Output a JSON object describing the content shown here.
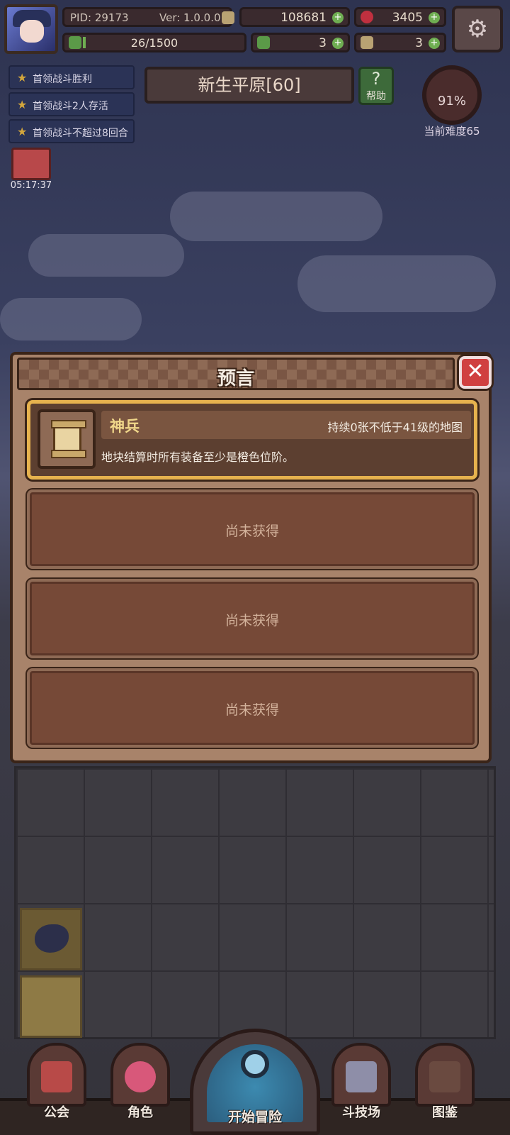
{
  "topbar": {
    "pid": "PID: 29173",
    "version": "Ver: 1.0.0.0",
    "coins": "108681",
    "gems": "3405",
    "xp": "26/1500",
    "res2": "3",
    "res3": "3",
    "xp_fraction": 0.017
  },
  "quests": [
    "首领战斗胜利",
    "首领战斗2人存活",
    "首领战斗不超过8回合"
  ],
  "chest_timer": "05:17:37",
  "map": {
    "title": "新生平原[60]",
    "help_label": "帮助",
    "difficulty_percent": "91%",
    "difficulty_label": "当前难度65"
  },
  "modal": {
    "title": "预言",
    "close_symbol": "✕",
    "prophecy": {
      "name": "神兵",
      "condition": "持续0张不低于41级的地图",
      "description": "地块结算时所有装备至少是橙色位阶。"
    },
    "empty_slots": [
      "尚未获得",
      "尚未获得",
      "尚未获得"
    ]
  },
  "nav": {
    "guild": "公会",
    "character": "角色",
    "adventure": "开始冒险",
    "arena": "斗技场",
    "codex": "图鉴"
  },
  "colors": {
    "accent_gold": "#e6b24e",
    "close_red": "#d04040",
    "panel_brown": "#a8836a"
  }
}
